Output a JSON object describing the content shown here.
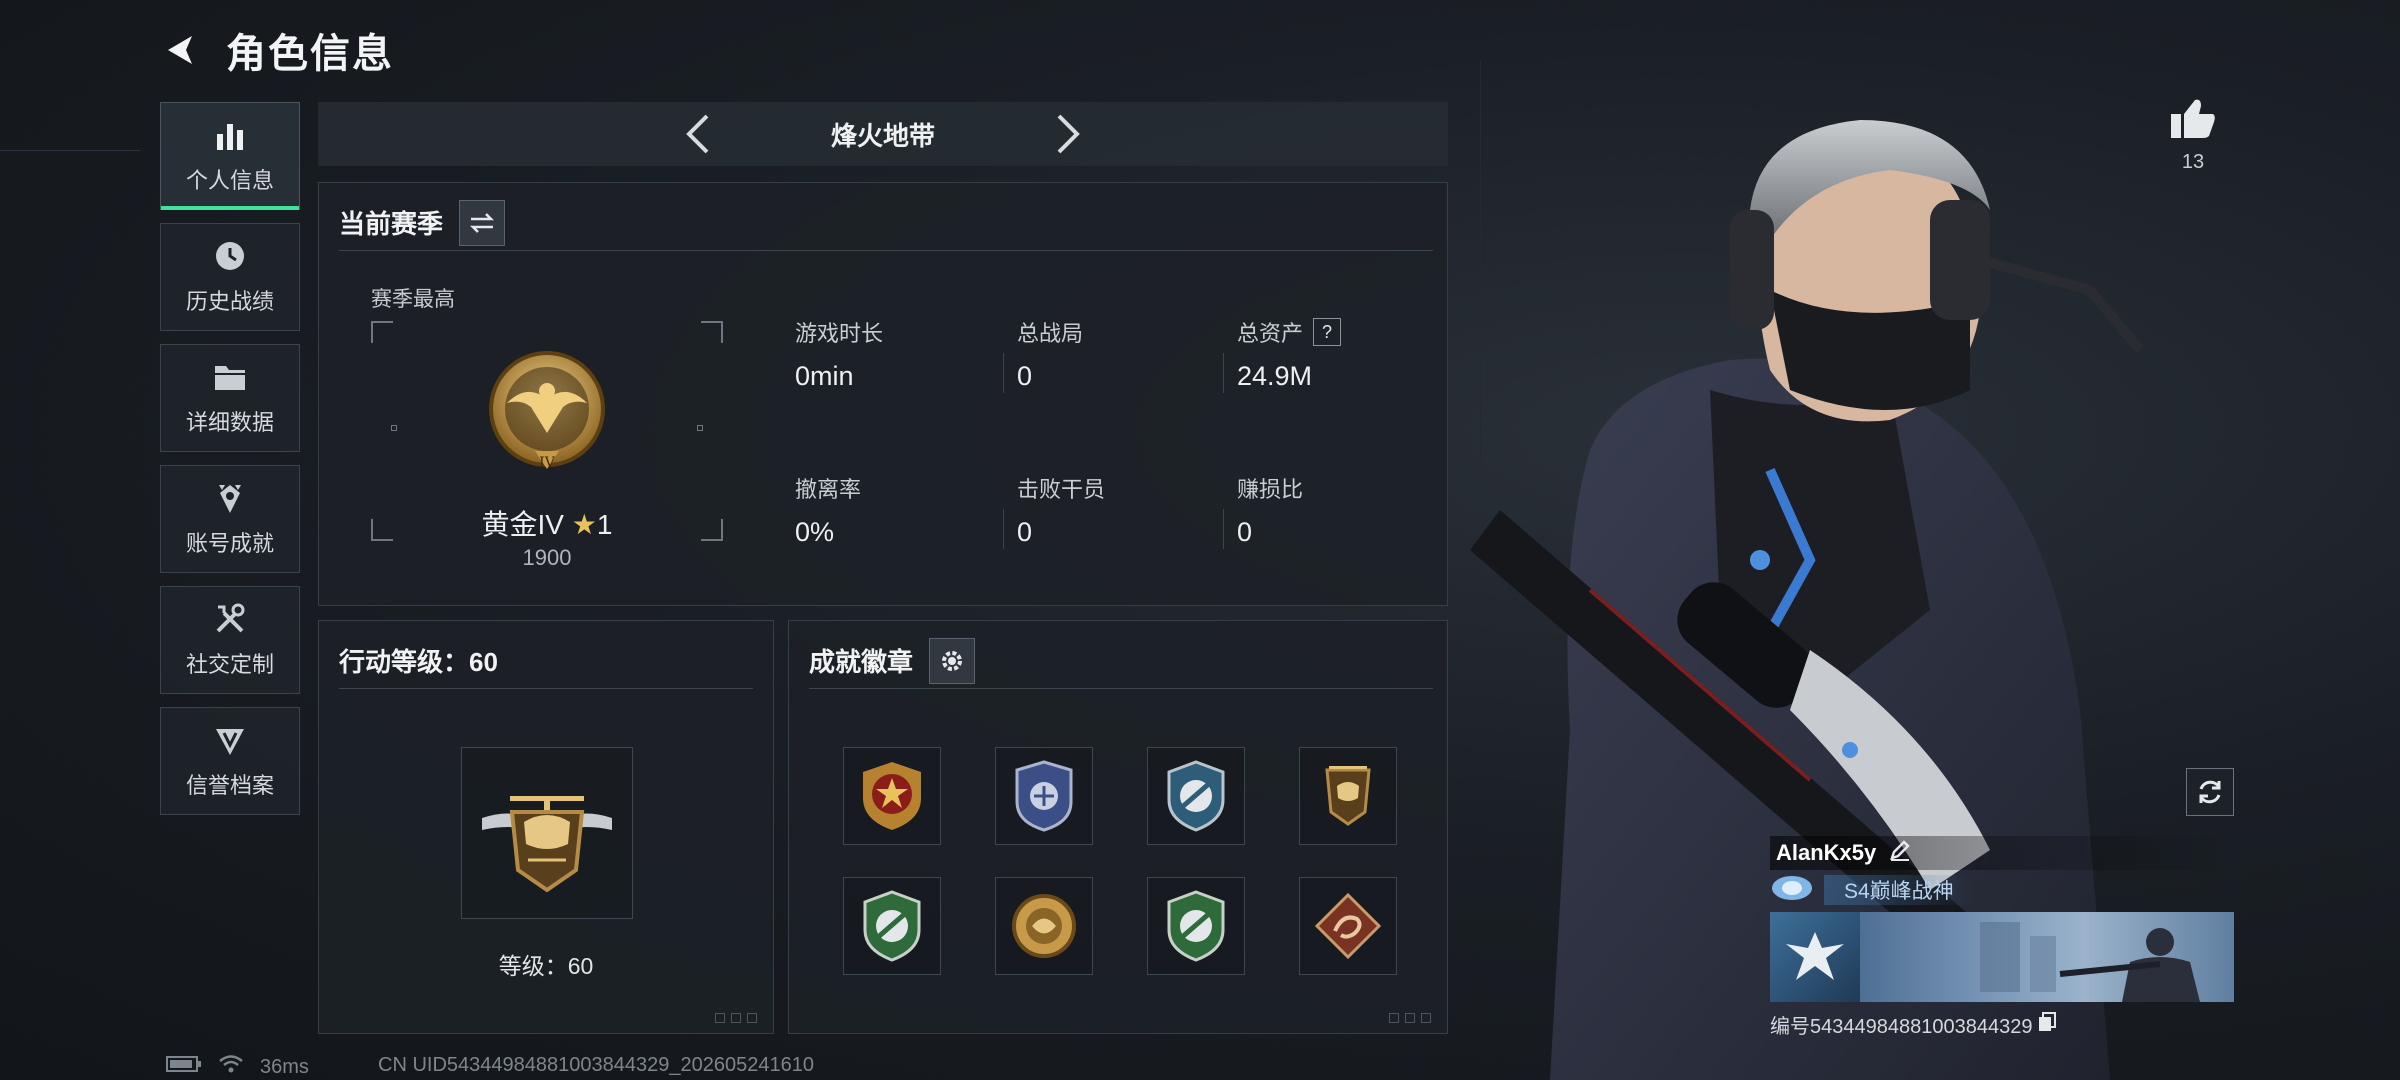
{
  "header": {
    "title": "角色信息"
  },
  "sidebar": {
    "items": [
      {
        "label": "个人信息",
        "icon": "bar-chart-icon"
      },
      {
        "label": "历史战绩",
        "icon": "clock-icon"
      },
      {
        "label": "详细数据",
        "icon": "folder-icon"
      },
      {
        "label": "账号成就",
        "icon": "achievement-icon"
      },
      {
        "label": "社交定制",
        "icon": "tools-icon"
      },
      {
        "label": "信誉档案",
        "icon": "shield-icon"
      }
    ]
  },
  "mode": {
    "title": "烽火地带"
  },
  "season": {
    "title": "当前赛季",
    "sub_label": "赛季最高",
    "rank_name": "黄金IV",
    "rank_stars": "1",
    "rank_score": "1900",
    "stats": [
      {
        "label": "游戏时长",
        "value": "0min"
      },
      {
        "label": "总战局",
        "value": "0"
      },
      {
        "label": "总资产",
        "value": "24.9M",
        "help": "?"
      },
      {
        "label": "撤离率",
        "value": "0%"
      },
      {
        "label": "击败干员",
        "value": "0"
      },
      {
        "label": "赚损比",
        "value": "0"
      }
    ]
  },
  "action_level": {
    "title": "行动等级：60",
    "level_text": "等级：60"
  },
  "badges": {
    "title": "成就徽章",
    "count": 8
  },
  "likes": {
    "count": "13"
  },
  "player": {
    "name": "AlanKx5y",
    "title": "S4巅峰战神",
    "id_text": "编号543449848810038443​29"
  },
  "status_bar": {
    "ping": "36ms",
    "uid": "CN UID5434498488100384432​9_202605241610"
  },
  "colors": {
    "accent": "#3fe39a",
    "panel": "#1c2127"
  }
}
